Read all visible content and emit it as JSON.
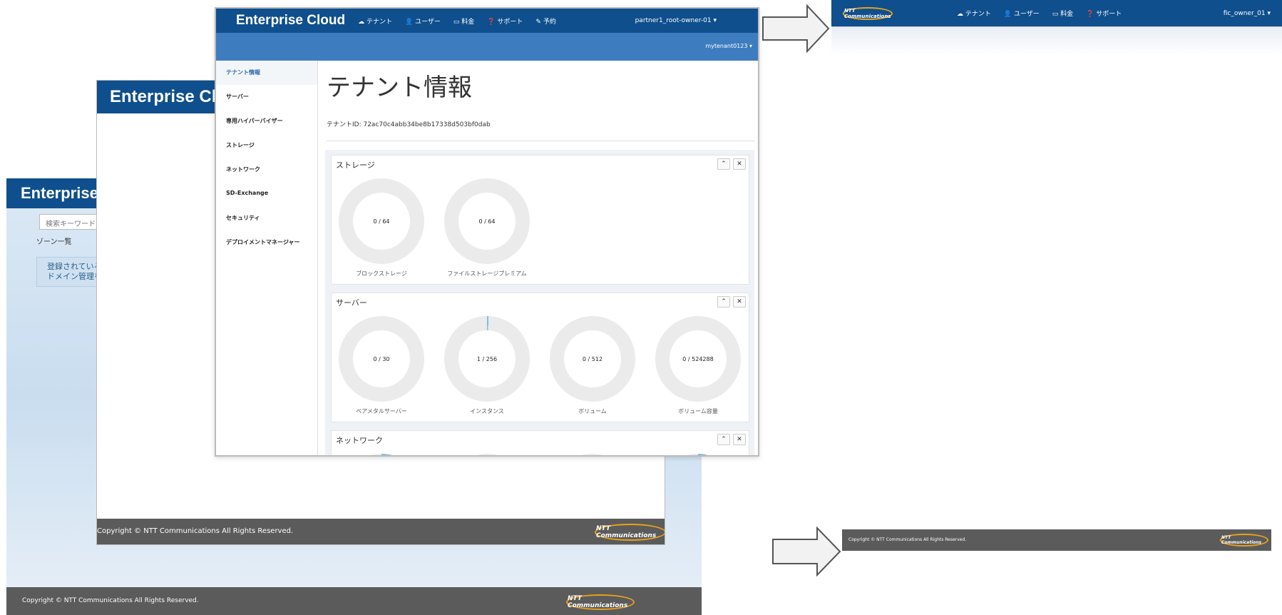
{
  "win3": {
    "app_title": "Enterprise C",
    "search_placeholder": "検索キーワード",
    "zone_label": "ゾーン一覧",
    "info_text_1": "登録されている",
    "info_text_2": "ドメイン管理を",
    "footer_copyright": "Copyright © NTT Communications All Rights Reserved.",
    "footer_logo": "NTT Communications"
  },
  "win2": {
    "app_title": "Enterprise Clo",
    "footer_copyright": "Copyright © NTT Communications All Rights Reserved.",
    "footer_logo": "NTT Communications"
  },
  "win1": {
    "brand": "Enterprise Cloud",
    "nav": [
      {
        "icon": "cloud-icon",
        "glyph": "☁",
        "label": "テナント"
      },
      {
        "icon": "user-icon",
        "glyph": "👤",
        "label": "ユーザー"
      },
      {
        "icon": "card-icon",
        "glyph": "▭",
        "label": "料金"
      },
      {
        "icon": "help-icon",
        "glyph": "❓",
        "label": "サポート"
      },
      {
        "icon": "contract-icon",
        "glyph": "✎",
        "label": "予約"
      }
    ],
    "user_menu": "partner1_root-owner-01 ▾",
    "tenant_selector": "mytenant0123 ▾",
    "sidebar": [
      "テナント情報",
      "サーバー",
      "専用ハイパーバイザー",
      "ストレージ",
      "ネットワーク",
      "SD-Exchange",
      "セキュリティ",
      "デプロイメントマネージャー"
    ],
    "page_title": "テナント情報",
    "tenant_id": "テナントID: 72ac70c4abb34be8b17338d503bf0dab",
    "panels": {
      "storage": {
        "title": "ストレージ",
        "items": [
          {
            "value": "0 / 64",
            "label": "ブロックストレージ",
            "used": 0
          },
          {
            "value": "0 / 64",
            "label": "ファイルストレージプレミアム",
            "used": 0
          }
        ]
      },
      "server": {
        "title": "サーバー",
        "items": [
          {
            "value": "0 / 30",
            "label": "ベアメタルサーバー",
            "used": 0
          },
          {
            "value": "1 / 256",
            "label": "インスタンス",
            "used": 0.0039
          },
          {
            "value": "0 / 512",
            "label": "ボリューム",
            "used": 0
          },
          {
            "value": "0 / 524288",
            "label": "ボリューム容量",
            "used": 0
          }
        ]
      },
      "network": {
        "title": "ネットワーク"
      }
    },
    "collapse_glyph": "⌃",
    "close_glyph": "✕"
  },
  "preview_header": {
    "logo": "NTT Communications",
    "nav": [
      "テナント",
      "ユーザー",
      "料金",
      "サポート"
    ],
    "user_menu": "fic_owner_01 ▾"
  },
  "preview_footer": {
    "copyright": "Copyright © NTT Communications All Rights Reserved.",
    "logo": "NTT Communications"
  },
  "colors": {
    "header_blue": "#0f4f8d",
    "subheader_blue": "#3e7cc0",
    "footer_gray": "#5b5b5b",
    "accent_teal": "#7fbfdc"
  }
}
